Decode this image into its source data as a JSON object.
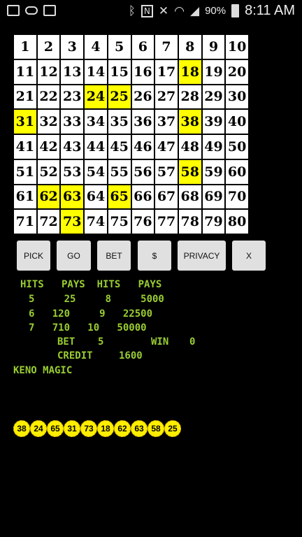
{
  "status_bar": {
    "battery_text": "90%",
    "time": "8:11 AM",
    "left_icons": [
      "image-icon",
      "voicemail-icon",
      "gallery-icon"
    ],
    "right_icons": [
      "bluetooth-icon",
      "nfc-icon",
      "mute-icon",
      "wifi-icon",
      "signal-icon",
      "battery-icon"
    ]
  },
  "board": {
    "numbers": [
      "1",
      "2",
      "3",
      "4",
      "5",
      "6",
      "7",
      "8",
      "9",
      "10",
      "11",
      "12",
      "13",
      "14",
      "15",
      "16",
      "17",
      "18",
      "19",
      "20",
      "21",
      "22",
      "23",
      "24",
      "25",
      "26",
      "27",
      "28",
      "29",
      "30",
      "31",
      "32",
      "33",
      "34",
      "35",
      "36",
      "37",
      "38",
      "39",
      "40",
      "41",
      "42",
      "43",
      "44",
      "45",
      "46",
      "47",
      "48",
      "49",
      "50",
      "51",
      "52",
      "53",
      "54",
      "55",
      "56",
      "57",
      "58",
      "59",
      "60",
      "61",
      "62",
      "63",
      "64",
      "65",
      "66",
      "67",
      "68",
      "69",
      "70",
      "71",
      "72",
      "73",
      "74",
      "75",
      "76",
      "77",
      "78",
      "79",
      "80"
    ],
    "highlighted": [
      "18",
      "24",
      "25",
      "31",
      "38",
      "58",
      "62",
      "63",
      "65",
      "73"
    ],
    "highlight_color": "#ffff00"
  },
  "buttons": {
    "pick": "PICK",
    "go": "GO",
    "bet": "BET",
    "dollar": "$",
    "privacy": "PRIVACY",
    "close": "X"
  },
  "paytable": {
    "header": "HITS   PAYS  HITS   PAYS",
    "rows": [
      "5     25     8     5000",
      "6   120     9   22500",
      "7   710   10   50000"
    ],
    "bet_label": "BET",
    "bet_value": "5",
    "win_label": "WIN",
    "win_value": "0",
    "credit_label": "CREDIT",
    "credit_value": "1600",
    "title": "KENO MAGIC",
    "text_color": "#9acd32"
  },
  "drawn_balls": [
    "38",
    "24",
    "65",
    "31",
    "73",
    "18",
    "62",
    "63",
    "58",
    "25"
  ]
}
